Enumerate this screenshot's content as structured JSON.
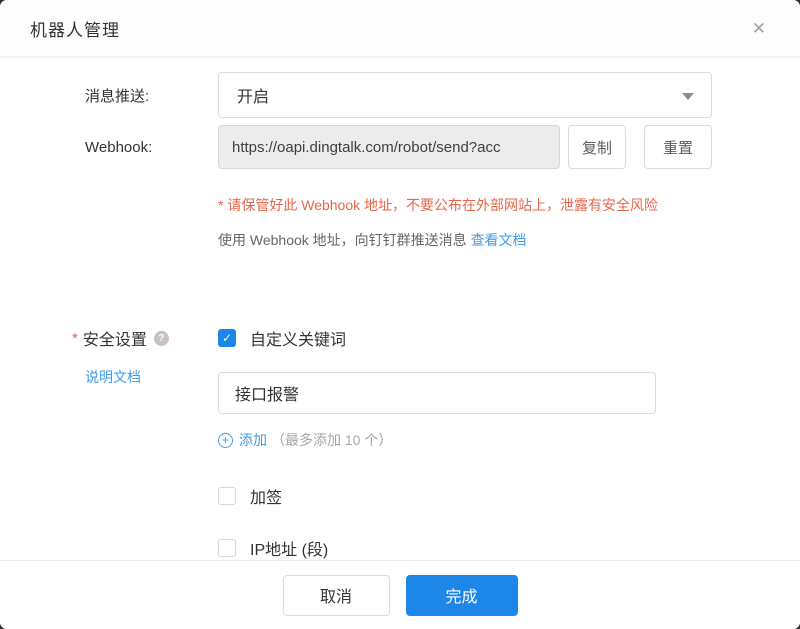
{
  "dialog": {
    "title": "机器人管理"
  },
  "icons": {
    "close": "✕",
    "check": "✓",
    "help": "?",
    "plus": "+"
  },
  "colors": {
    "accent_blue": "#1C87E8",
    "link_blue": "#3E9BE9",
    "warning_orange": "#E8654A"
  },
  "form": {
    "push": {
      "label": "消息推送:",
      "value": "开启"
    },
    "webhook": {
      "label": "Webhook:",
      "value": "https://oapi.dingtalk.com/robot/send?acc",
      "copy_label": "复制",
      "reset_label": "重置",
      "warning": "* 请保管好此 Webhook 地址，不要公布在外部网站上，泄露有安全风险",
      "usage_text": "使用 Webhook 地址，向钉钉群推送消息",
      "usage_link": "查看文档"
    },
    "security": {
      "required_mark": "*",
      "label": "安全设置",
      "doc_link": "说明文档",
      "keyword": {
        "label": "自定义关键词",
        "checked": true,
        "value": "接口报警"
      },
      "add_label": "添加",
      "add_hint": "（最多添加 10 个）",
      "sign": {
        "label": "加签",
        "checked": false
      },
      "ip": {
        "label": "IP地址 (段)",
        "checked": false
      }
    }
  },
  "footer": {
    "cancel_label": "取消",
    "confirm_label": "完成"
  }
}
